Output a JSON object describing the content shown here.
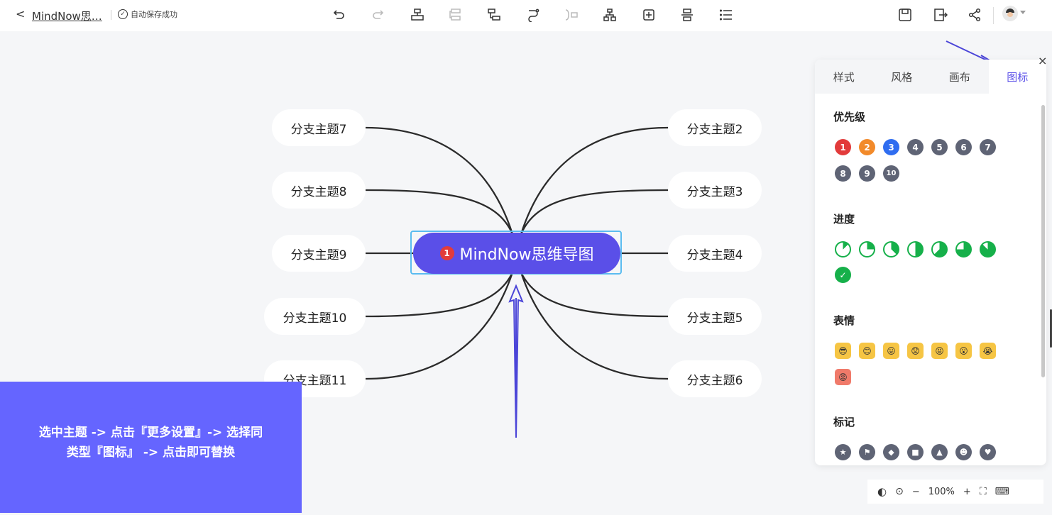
{
  "header": {
    "back": "<",
    "title": "MindNow思…",
    "save_status": "自动保存成功"
  },
  "toolbar_icons": [
    "undo-icon",
    "redo-icon",
    "insert-parent-icon",
    "insert-sibling-icon",
    "insert-child-icon",
    "relation-line-icon",
    "summary-icon",
    "structure-icon",
    "insert-icon",
    "remove-topic-icon",
    "outline-icon"
  ],
  "right_icons": [
    "save-icon",
    "export-icon",
    "share-icon",
    "avatar"
  ],
  "mindmap": {
    "root": {
      "label": "MindNow思维导图",
      "priority": "1"
    },
    "left": [
      "分支主题7",
      "分支主题8",
      "分支主题9",
      "分支主题10",
      "分支主题11"
    ],
    "right": [
      "分支主题2",
      "分支主题3",
      "分支主题4",
      "分支主题5",
      "分支主题6"
    ]
  },
  "panel": {
    "tabs": [
      "样式",
      "风格",
      "画布",
      "图标"
    ],
    "active_tab": "图标",
    "close": "×",
    "sections": {
      "priority": {
        "title": "优先级",
        "items": [
          "1",
          "2",
          "3",
          "4",
          "5",
          "6",
          "7",
          "8",
          "9",
          "10"
        ],
        "colors": [
          "#e23b3b",
          "#f28a2a",
          "#2f6df0",
          "#5f6475",
          "#5f6475",
          "#5f6475",
          "#5f6475",
          "#5f6475",
          "#5f6475",
          "#5f6475"
        ]
      },
      "progress": {
        "title": "进度",
        "levels": [
          0.125,
          0.25,
          0.375,
          0.5,
          0.625,
          0.75,
          0.875,
          1.0
        ]
      },
      "emoji": {
        "title": "表情",
        "items": [
          "😎",
          "😊",
          "😛",
          "😟",
          "😝",
          "😮",
          "😭",
          "😡"
        ]
      },
      "marks": {
        "title": "标记",
        "items": [
          "★",
          "⚑",
          "◆",
          "■",
          "▲",
          "☻",
          "♥"
        ]
      }
    }
  },
  "tip": {
    "text": "选中主题 -> 点击『更多设置』-> 选择同类型『图标』 -> 点击即可替换"
  },
  "zoom": {
    "minus": "−",
    "level": "100%",
    "plus": "+"
  },
  "colors": {
    "accent": "#5a4fe8",
    "tip_bg": "#6565ff",
    "priority_red": "#e23b3b",
    "progress_green": "#16b04a",
    "arrow": "#4b45d8"
  }
}
